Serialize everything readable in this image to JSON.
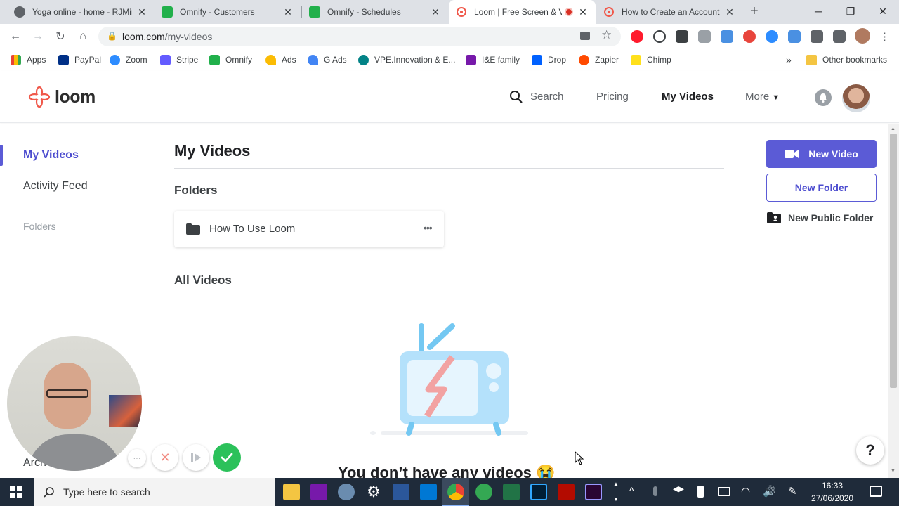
{
  "browser": {
    "tabs": [
      {
        "title": "Yoga online - home - RJMin",
        "active": false
      },
      {
        "title": "Omnify - Customers",
        "active": false
      },
      {
        "title": "Omnify - Schedules",
        "active": false
      },
      {
        "title": "Loom | Free Screen & V",
        "active": true
      },
      {
        "title": "How to Create an Account",
        "active": false
      }
    ],
    "url_host": "loom.com",
    "url_path": "/my-videos",
    "bookmarks": [
      {
        "label": "Apps",
        "color": "#ea4335"
      },
      {
        "label": "PayPal",
        "color": "#003087"
      },
      {
        "label": "Zoom",
        "color": "#2d8cff"
      },
      {
        "label": "Stripe",
        "color": "#635bff"
      },
      {
        "label": "Omnify",
        "color": "#21b04b"
      },
      {
        "label": "Ads",
        "color": "#fbbc04"
      },
      {
        "label": "G Ads",
        "color": "#4285f4"
      },
      {
        "label": "VPE.Innovation & E...",
        "color": "#038387"
      },
      {
        "label": "I&E family",
        "color": "#7719aa"
      },
      {
        "label": "Drop",
        "color": "#0061ff"
      },
      {
        "label": "Zapier",
        "color": "#ff4a00"
      },
      {
        "label": "Chimp",
        "color": "#ffe01b"
      }
    ],
    "overflow": "»",
    "other_bookmarks": "Other bookmarks"
  },
  "loom": {
    "logo": "loom",
    "nav": {
      "search": "Search",
      "pricing": "Pricing",
      "my_videos": "My Videos",
      "more": "More"
    },
    "sidebar": {
      "items": [
        {
          "label": "My Videos",
          "active": true
        },
        {
          "label": "Activity Feed",
          "active": false
        }
      ],
      "folders_heading": "Folders",
      "archive_partial": "Arch"
    },
    "main": {
      "title": "My Videos",
      "folders_heading": "Folders",
      "folder_name": "How To Use Loom",
      "folder_menu": "•••",
      "all_videos_heading": "All Videos",
      "empty_text": "You don’t have any videos 😭"
    },
    "actions": {
      "new_video": "New Video",
      "new_folder": "New Folder",
      "new_public_folder": "New Public Folder"
    },
    "help": "?",
    "recorder": {
      "more": "···"
    }
  },
  "taskbar": {
    "search_placeholder": "Type here to search",
    "time": "16:33",
    "date": "27/06/2020"
  },
  "colors": {
    "loom_brand": "#f0584a",
    "accent": "#5b5bd6",
    "taskbar": "#1f2b3a",
    "confirm_green": "#2bc15a"
  }
}
